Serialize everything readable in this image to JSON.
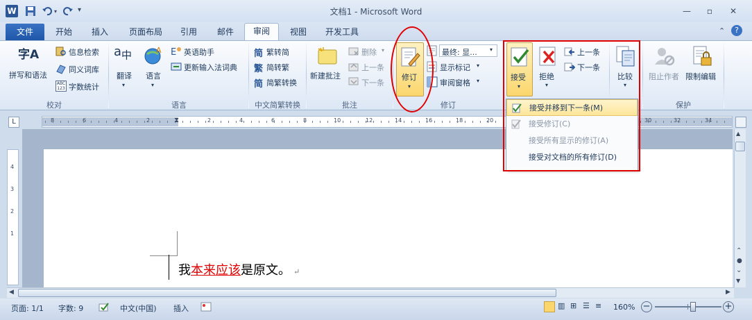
{
  "window": {
    "title": "文档1 - Microsoft Word",
    "app_icon": "W"
  },
  "tabs": [
    {
      "label": "文件"
    },
    {
      "label": "开始"
    },
    {
      "label": "插入"
    },
    {
      "label": "页面布局"
    },
    {
      "label": "引用"
    },
    {
      "label": "邮件"
    },
    {
      "label": "审阅"
    },
    {
      "label": "视图"
    },
    {
      "label": "开发工具"
    }
  ],
  "groups": {
    "proofing": {
      "label": "校对",
      "spell": "拼写和语法",
      "research": "信息检索",
      "thesaurus": "同义词库",
      "wordcount": "字数统计",
      "spell_icon_text": "字A",
      "wordcount_icon_text": "ABC 123"
    },
    "language": {
      "label": "语言",
      "translate": "翻译",
      "language": "语言",
      "english_assistant": "英语助手",
      "update_ime": "更新输入法词典"
    },
    "chinese": {
      "label": "中文简繁转换",
      "to_simplified": "繁转简",
      "to_traditional": "简转繁",
      "convert": "简繁转换"
    },
    "comments": {
      "label": "批注",
      "new": "新建批注",
      "delete": "删除",
      "previous": "上一条",
      "next": "下一条"
    },
    "tracking": {
      "label": "修订",
      "track": "修订",
      "display": "最终: 显...",
      "show_markup": "显示标记",
      "reviewing_pane": "审阅窗格"
    },
    "changes": {
      "accept": "接受",
      "reject": "拒绝",
      "previous": "上一条",
      "next": "下一条"
    },
    "compare": {
      "compare": "比较"
    },
    "protect": {
      "label": "保护",
      "block_authors": "阻止作者",
      "restrict": "限制编辑"
    }
  },
  "accept_menu": [
    {
      "label": "接受并移到下一条(M)",
      "enabled": true,
      "highlighted": true
    },
    {
      "label": "接受修订(C)",
      "enabled": false,
      "highlighted": false
    },
    {
      "label": "接受所有显示的修订(A)",
      "enabled": false,
      "highlighted": false
    },
    {
      "label": "接受对文档的所有修订(D)",
      "enabled": true,
      "highlighted": false
    }
  ],
  "ruler": {
    "marks": [
      "8",
      "6",
      "4",
      "2",
      "2",
      "4",
      "6",
      "8",
      "10",
      "12",
      "14",
      "16",
      "18",
      "20",
      "30",
      "32",
      "34"
    ],
    "vmarks": [
      "4",
      "3",
      "2",
      "1"
    ]
  },
  "document": {
    "before": "我",
    "inserted": "本来应该",
    "after": "是原文。",
    "mark": "↵"
  },
  "status": {
    "page": "页面: 1/1",
    "words": "字数: 9",
    "language": "中文(中国)",
    "mode": "插入",
    "zoom": "160%",
    "zoom_level_percent": 160
  },
  "colors": {
    "accent": "#2b5797",
    "annotation": "#e00000",
    "inserted_text": "#e00000",
    "highlight": "#fde69a"
  }
}
